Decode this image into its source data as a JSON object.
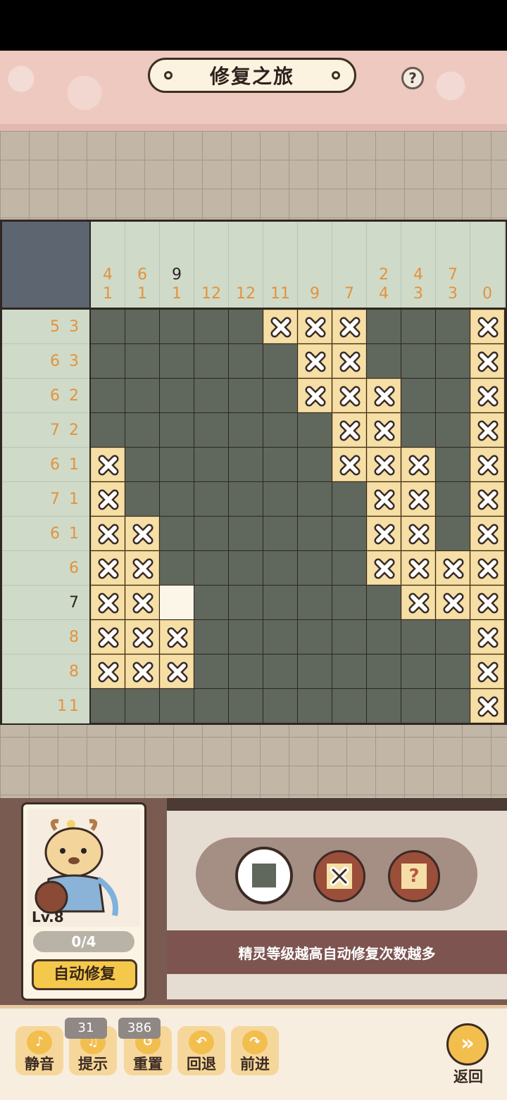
{
  "header": {
    "title": "修复之旅",
    "help": "?"
  },
  "puzzle": {
    "column_clues": [
      [
        "4",
        "1"
      ],
      [
        "6",
        "1"
      ],
      [
        "9",
        "1"
      ],
      [
        "12"
      ],
      [
        "12"
      ],
      [
        "11"
      ],
      [
        "9"
      ],
      [
        "7"
      ],
      [
        "2",
        "4"
      ],
      [
        "4",
        "3"
      ],
      [
        "7",
        "3"
      ],
      [
        "0"
      ]
    ],
    "row_clues": [
      "5 3",
      "6 3",
      "6 2",
      "7 2",
      "6 1",
      "7 1",
      "6 1",
      "6",
      "7",
      "8",
      "8",
      "11"
    ],
    "grid": [
      "FFFFFXXXFFFX",
      "FFFFFFXXFFFX",
      "FFFFFFXXXFFX",
      "FFFFFFFXXFFX",
      "XFFFFFFXXXFX",
      "XFFFFFFFXXFX",
      "XXFFFFFFXXFX",
      "XXFFFFFFXXXX",
      "XXEFFFFFFXXX",
      "XXXFFFFFFFFX",
      "XXXFFFFFFFFX",
      "FFFFFFFFFFFX"
    ],
    "colors": {
      "filled": "#60675c",
      "cross": "#f5dfa6",
      "empty": "#fbf6e8",
      "clue": "#e3923f"
    }
  },
  "sprite": {
    "level": "Lv.8",
    "progress": "0/4",
    "auto_button": "自动修复"
  },
  "tools": {
    "fill": "fill",
    "cross": "cross",
    "question": "?"
  },
  "tip": "精灵等级越高自动修复次数越多",
  "footer": {
    "mute": "静音",
    "hint": "提示",
    "hint_count": "31",
    "reset": "重置",
    "reset_count": "386",
    "undo": "回退",
    "redo": "前进",
    "back": "返回"
  }
}
